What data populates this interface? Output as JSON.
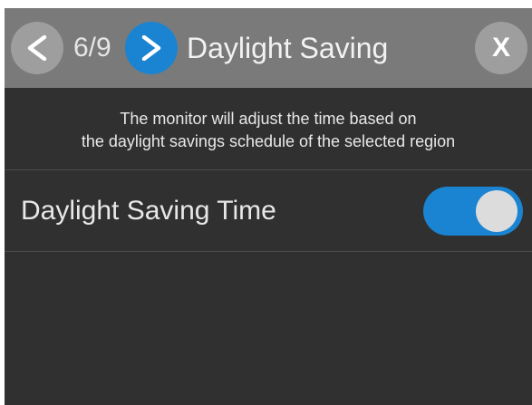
{
  "header": {
    "page_counter": "6/9",
    "title": "Daylight Saving",
    "close_label": "X",
    "prev_icon": "chevron-left-icon",
    "next_icon": "chevron-right-icon"
  },
  "description": {
    "line1": "The monitor will adjust the time based on",
    "line2": "the daylight savings schedule of the selected region"
  },
  "settings": [
    {
      "label": "Daylight Saving Time",
      "enabled": true
    }
  ],
  "colors": {
    "accent": "#1a84d2",
    "header_bg": "#7a7a7a",
    "screen_bg": "#303030",
    "button_gray": "#9e9e9e",
    "toggle_knob": "#dcdcdc"
  }
}
